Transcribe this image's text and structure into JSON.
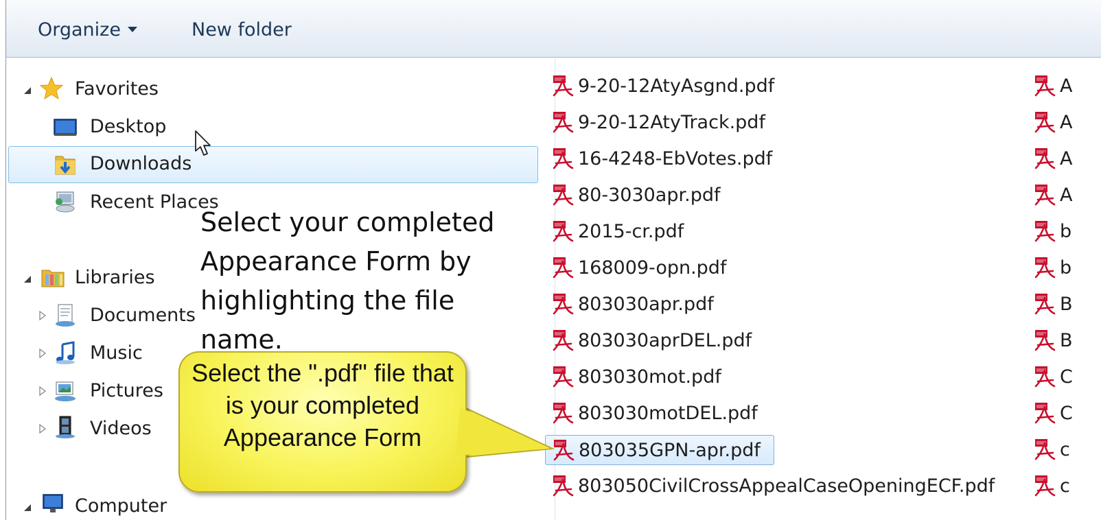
{
  "toolbar": {
    "organize_label": "Organize",
    "new_folder_label": "New folder"
  },
  "nav": {
    "favorites": "Favorites",
    "desktop": "Desktop",
    "downloads": "Downloads",
    "recent_places": "Recent Places",
    "libraries": "Libraries",
    "documents": "Documents",
    "music": "Music",
    "pictures": "Pictures",
    "videos": "Videos",
    "computer": "Computer"
  },
  "files": {
    "column1": [
      "9-20-12AtyAsgnd.pdf",
      "9-20-12AtyTrack.pdf",
      "16-4248-EbVotes.pdf",
      "80-3030apr.pdf",
      "2015-cr.pdf",
      "168009-opn.pdf",
      "803030apr.pdf",
      "803030aprDEL.pdf",
      "803030mot.pdf",
      "803030motDEL.pdf",
      "803035GPN-apr.pdf",
      "803050CivilCrossAppealCaseOpeningECF.pdf"
    ],
    "column2": [
      "A",
      "A",
      "A",
      "A",
      "b",
      "b",
      "B",
      "B",
      "C",
      "C",
      "c",
      "c"
    ],
    "selected_index": 10
  },
  "annotations": {
    "instruction": "Select your completed Appearance Form by highlighting the file name.",
    "callout": "Select the \".pdf\" file that is your completed Appearance Form"
  },
  "colors": {
    "selection_border": "#7db2e0",
    "callout_fill": "#f8f45a",
    "toolbar_text": "#1e3959",
    "pdf_red": "#c8102e"
  }
}
